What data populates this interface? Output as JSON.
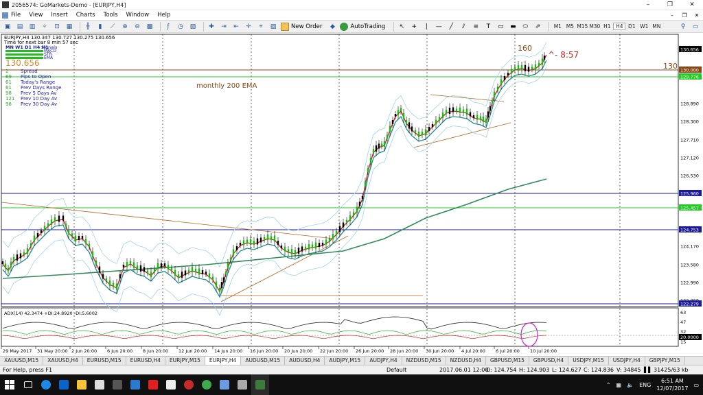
{
  "window": {
    "title": "2056574: GoMarkets-Demo - [EURJPY,H4]",
    "controls": [
      "–",
      "❐",
      "✕"
    ]
  },
  "menu": [
    "File",
    "View",
    "Insert",
    "Charts",
    "Tools",
    "Window",
    "Help"
  ],
  "toolbar": {
    "new_order": "New Order",
    "autotrading": "AutoTrading",
    "timeframes": [
      "M1",
      "M5",
      "M15",
      "M30",
      "H1",
      "H4",
      "D1",
      "W1",
      "MN"
    ],
    "active_timeframe": "H4"
  },
  "chart": {
    "header": "EURJPY,H4  130.347 130.727 130.275 130.656",
    "timer": "Time for next bar 8 min 57 sec",
    "panel_label": "MN W1 D1 H4 H1",
    "signals_label": "Signals",
    "ma_labels": [
      "MACD",
      "STR",
      "EMA"
    ],
    "big_price": "130.656",
    "stats": [
      {
        "value": "2",
        "label": "Spread"
      },
      {
        "value": "69",
        "label": "Pips to Open"
      },
      {
        "value": "61",
        "label": "Today's Range"
      },
      {
        "value": "61",
        "label": "Prev Days Range"
      },
      {
        "value": "98",
        "label": "Prev 5 Days Av"
      },
      {
        "value": "121",
        "label": "Prev 10 Day Av"
      },
      {
        "value": "98",
        "label": "Prev 30 Day Av"
      }
    ],
    "annotation_ema": "monthly 200 EMA",
    "annotation_160": "160",
    "annotation_130": "130",
    "annotation_timer": "^- 8:57",
    "price_labels": [
      {
        "text": "130.656",
        "kind": "current"
      },
      {
        "text": "130.000",
        "kind": "brown"
      },
      {
        "text": "129.776",
        "kind": "green"
      },
      {
        "text": "128.890",
        "kind": "tick"
      },
      {
        "text": "128.300",
        "kind": "tick"
      },
      {
        "text": "127.710",
        "kind": "tick"
      },
      {
        "text": "127.120",
        "kind": "tick"
      },
      {
        "text": "126.530",
        "kind": "tick"
      },
      {
        "text": "125.960",
        "kind": "blue"
      },
      {
        "text": "125.457",
        "kind": "green"
      },
      {
        "text": "124.753",
        "kind": "blue"
      },
      {
        "text": "124.170",
        "kind": "tick"
      },
      {
        "text": "123.580",
        "kind": "tick"
      },
      {
        "text": "122.990",
        "kind": "tick"
      },
      {
        "text": "122.400",
        "kind": "tick"
      },
      {
        "text": "122.279",
        "kind": "blue"
      }
    ],
    "adx_label": "ADX(14) 42.3474 +DI:24.8920 -DI:5.6002",
    "adx_scale": [
      "63",
      "47",
      "32",
      "20.0000",
      "15"
    ],
    "dates": [
      "29 May 2017",
      "31 May 20:00",
      "2 Jun 20:00",
      "6 Jun 20:00",
      "8 Jun 20:00",
      "12 Jun 20:00",
      "14 Jun 20:00",
      "16 Jun 20:00",
      "20 Jun 20:00",
      "22 Jun 20:00",
      "26 Jun 20:00",
      "28 Jun 20:00",
      "30 Jun 20:00",
      "4 Jul 20:00",
      "6 Jul 20:00",
      "10 Jul 20:00"
    ]
  },
  "tabs": [
    "XAUUSD,M15",
    "XAUUSD,H4",
    "EURUSD,M15",
    "EURUSD,H4",
    "EURJPY,M15",
    "EURJPY,H4",
    "AUDUSD,M15",
    "AUDUSD,H4",
    "AUDJPY,M15",
    "AUDJPY,H4",
    "NZDUSD,M15",
    "NZDUSD,H4",
    "GBPUSD,M15",
    "GBPUSD,H4",
    "USDJPY,M15",
    "USDJPY,H4",
    "GBPJPY,M15"
  ],
  "active_tab": "EURJPY,H4",
  "status": {
    "help": "For Help, press F1",
    "profile": "Default",
    "time": "2017.06.01 12:00",
    "open": "O: 124.754",
    "high": "H: 124.903",
    "low": "L: 124.627",
    "close": "C: 124.836",
    "volume": "V: 34845",
    "traffic": "31425/63 kb"
  },
  "taskbar": {
    "lang": "ENG",
    "time": "6:51 AM",
    "date": "12/07/2017"
  }
}
